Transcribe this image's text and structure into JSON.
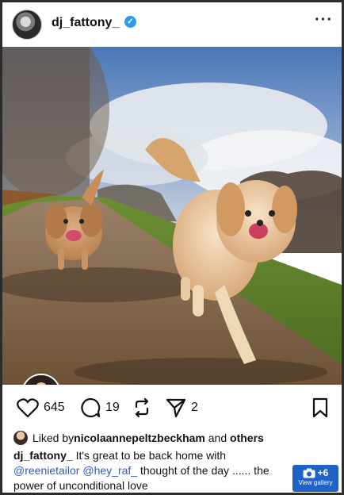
{
  "post": {
    "username": "dj_fattony_",
    "more_icon": "more-horizontal-icon"
  },
  "actions": {
    "likes_count": "645",
    "comments_count": "19",
    "shares_count": "2"
  },
  "liked_by": {
    "prefix": "Liked by ",
    "user": "nicolaannepeltzbeckham",
    "joiner": " and ",
    "others": "others"
  },
  "caption": {
    "author": "dj_fattony_",
    "text_1": " It's great to be back home with ",
    "mention_1": "@reenietailor",
    "space": " ",
    "mention_2": "@hey_raf_",
    "text_2": " thought of the day ...... the",
    "text_3": "power of unconditional love"
  },
  "gallery": {
    "count": "+6",
    "label": "View gallery"
  },
  "colors": {
    "verified": "#2d9cf0",
    "mention": "#2f5bbf",
    "gallery_bg": "#1f63c8",
    "story_heart": "#ff3d7f"
  }
}
